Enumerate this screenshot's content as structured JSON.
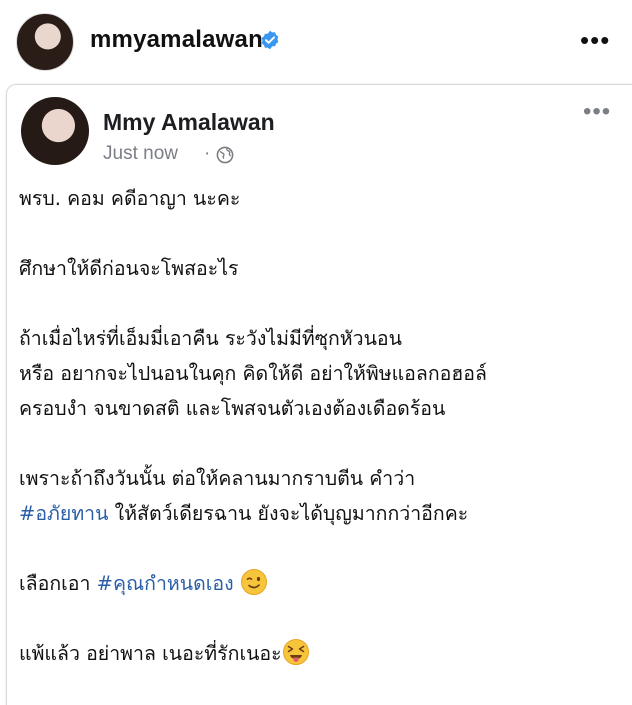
{
  "ig_header": {
    "username": "mmyamalawan",
    "more_label": "•••"
  },
  "fb_post": {
    "author": "Mmy Amalawan",
    "time": "Just now",
    "separator": "·",
    "more_label": "•••",
    "lines": {
      "l1": "พรบ. คอม คดีอาญา นะคะ",
      "l2": "ศึกษาให้ดีก่อนจะโพสอะไร",
      "l3": "ถ้าเมื่อไหร่ที่เอ็มมี่เอาคืน ระวังไม่มีที่ซุกหัวนอน",
      "l4": "หรือ อยากจะไปนอนในคุก คิดให้ดี อย่าให้พิษแอลกอฮอล์",
      "l5": "ครอบงำ จนขาดสติ และโพสจนตัวเองต้องเดือดร้อน",
      "l6": "เพราะถ้าถึงวันนั้น ต่อให้คลานมากราบตีน คำว่า",
      "l7_hashtag": "#อภัยทาน",
      "l7_rest": " ให้สัตว์เดียรฉาน ยังจะได้บุญมากกว่าอีกคะ",
      "l8_prefix": " เลือกเอา ",
      "l8_hashtag": "#คุณกำหนดเอง",
      "l9": "แพ้แล้ว อย่าพาล เนอะที่รักเนอะ"
    }
  },
  "colors": {
    "hashtag": "#2b5ea7",
    "verified": "#3897f0",
    "secondary_text": "#7b7f85"
  },
  "icons": {
    "verified": "verified-badge-icon",
    "privacy": "globe-icon",
    "emoji_wink": "winking-face-icon",
    "emoji_tongue": "squinting-tongue-face-icon"
  }
}
